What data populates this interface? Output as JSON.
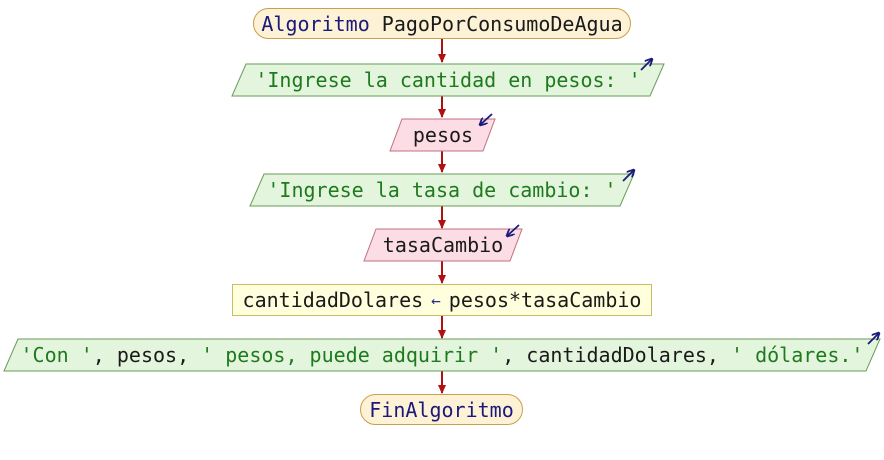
{
  "start": {
    "keyword": "Algoritmo",
    "name": "PagoPorConsumoDeAgua"
  },
  "output1": {
    "text": "'Ingrese la cantidad en pesos: '"
  },
  "input1": {
    "text": "pesos"
  },
  "output2": {
    "text": "'Ingrese la tasa de cambio: '"
  },
  "input2": {
    "text": "tasaCambio"
  },
  "assign": {
    "target": "cantidadDolares",
    "op": "←",
    "expr": "pesos*tasaCambio"
  },
  "output3": {
    "s1": "'Con '",
    "sep1": ", ",
    "v1": "pesos",
    "sep2": ", ",
    "s2": "' pesos, puede adquirir '",
    "sep3": ", ",
    "v2": "cantidadDolares",
    "sep4": ", ",
    "s3": "' dólares.'"
  },
  "end": {
    "text": "FinAlgoritmo"
  },
  "colors": {
    "flow_arrow": "#b01010",
    "output_fill": "#e3f5dc",
    "input_fill": "#fcdde6",
    "io_icon": "#1a1a7a"
  }
}
